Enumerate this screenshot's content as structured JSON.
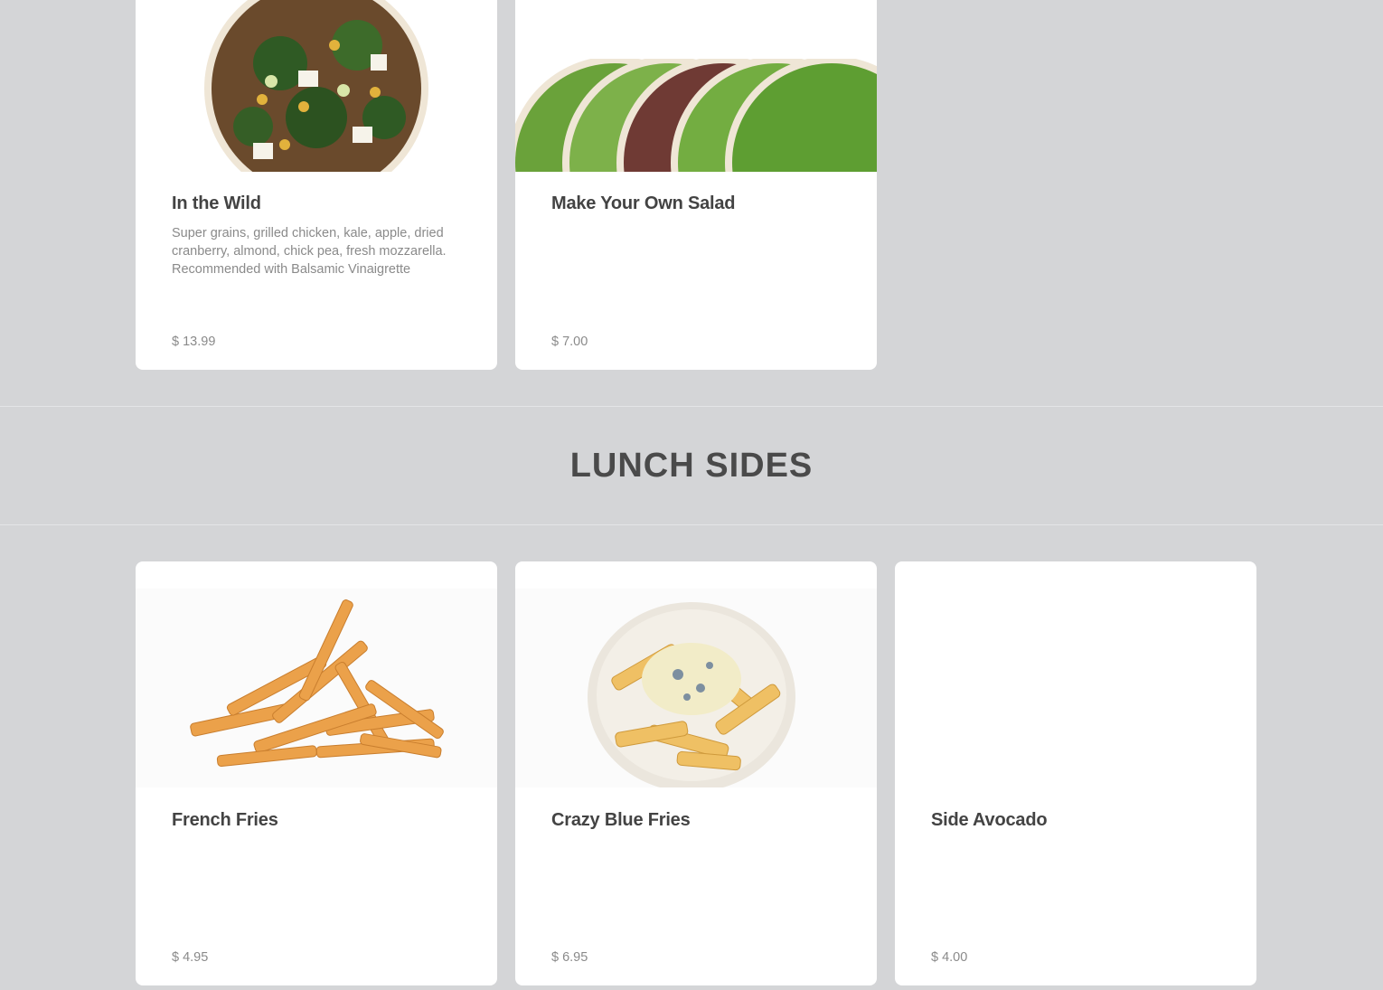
{
  "top_row": {
    "items": [
      {
        "name": "In the Wild",
        "description": "Super grains, grilled chicken, kale, apple, dried cranberry, almond, chick pea, fresh mozzarella. Recommended with Balsamic Vinaigrette",
        "price": "$ 13.99"
      },
      {
        "name": "Make Your Own Salad",
        "description": "",
        "price": "$ 7.00"
      }
    ]
  },
  "section": {
    "title": "LUNCH SIDES"
  },
  "sides": {
    "items": [
      {
        "name": "French Fries",
        "price": "$ 4.95"
      },
      {
        "name": "Crazy Blue Fries",
        "price": "$ 6.95"
      },
      {
        "name": "Side Avocado",
        "price": "$ 4.00"
      }
    ]
  }
}
